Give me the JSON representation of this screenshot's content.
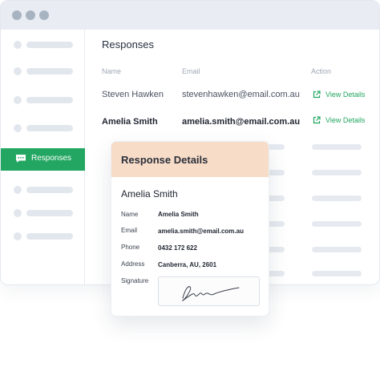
{
  "sidebar": {
    "active_item": {
      "label": "Responses",
      "icon": "chat-bubble-icon"
    }
  },
  "main": {
    "title": "Responses",
    "columns": {
      "name": "Name",
      "email": "Email",
      "action": "Action"
    },
    "rows": [
      {
        "name": "Steven Hawken",
        "email": "stevenhawken@email.com.au",
        "action": "View Details"
      },
      {
        "name": "Amelia Smith",
        "email": "amelia.smith@email.com.au",
        "action": "View Details"
      }
    ]
  },
  "card": {
    "title": "Response Details",
    "name": "Amelia Smith",
    "fields": [
      {
        "label": "Name",
        "value": "Amelia Smith"
      },
      {
        "label": "Email",
        "value": "amelia.smith@email.com.au"
      },
      {
        "label": "Phone",
        "value": "0432 172 622"
      },
      {
        "label": "Address",
        "value": "Canberra, AU, 2601"
      },
      {
        "label": "Signature",
        "value": ""
      }
    ]
  },
  "colors": {
    "accent": "#22a661",
    "card_header": "#f7dcc8",
    "titlebar": "#e9edf3"
  }
}
